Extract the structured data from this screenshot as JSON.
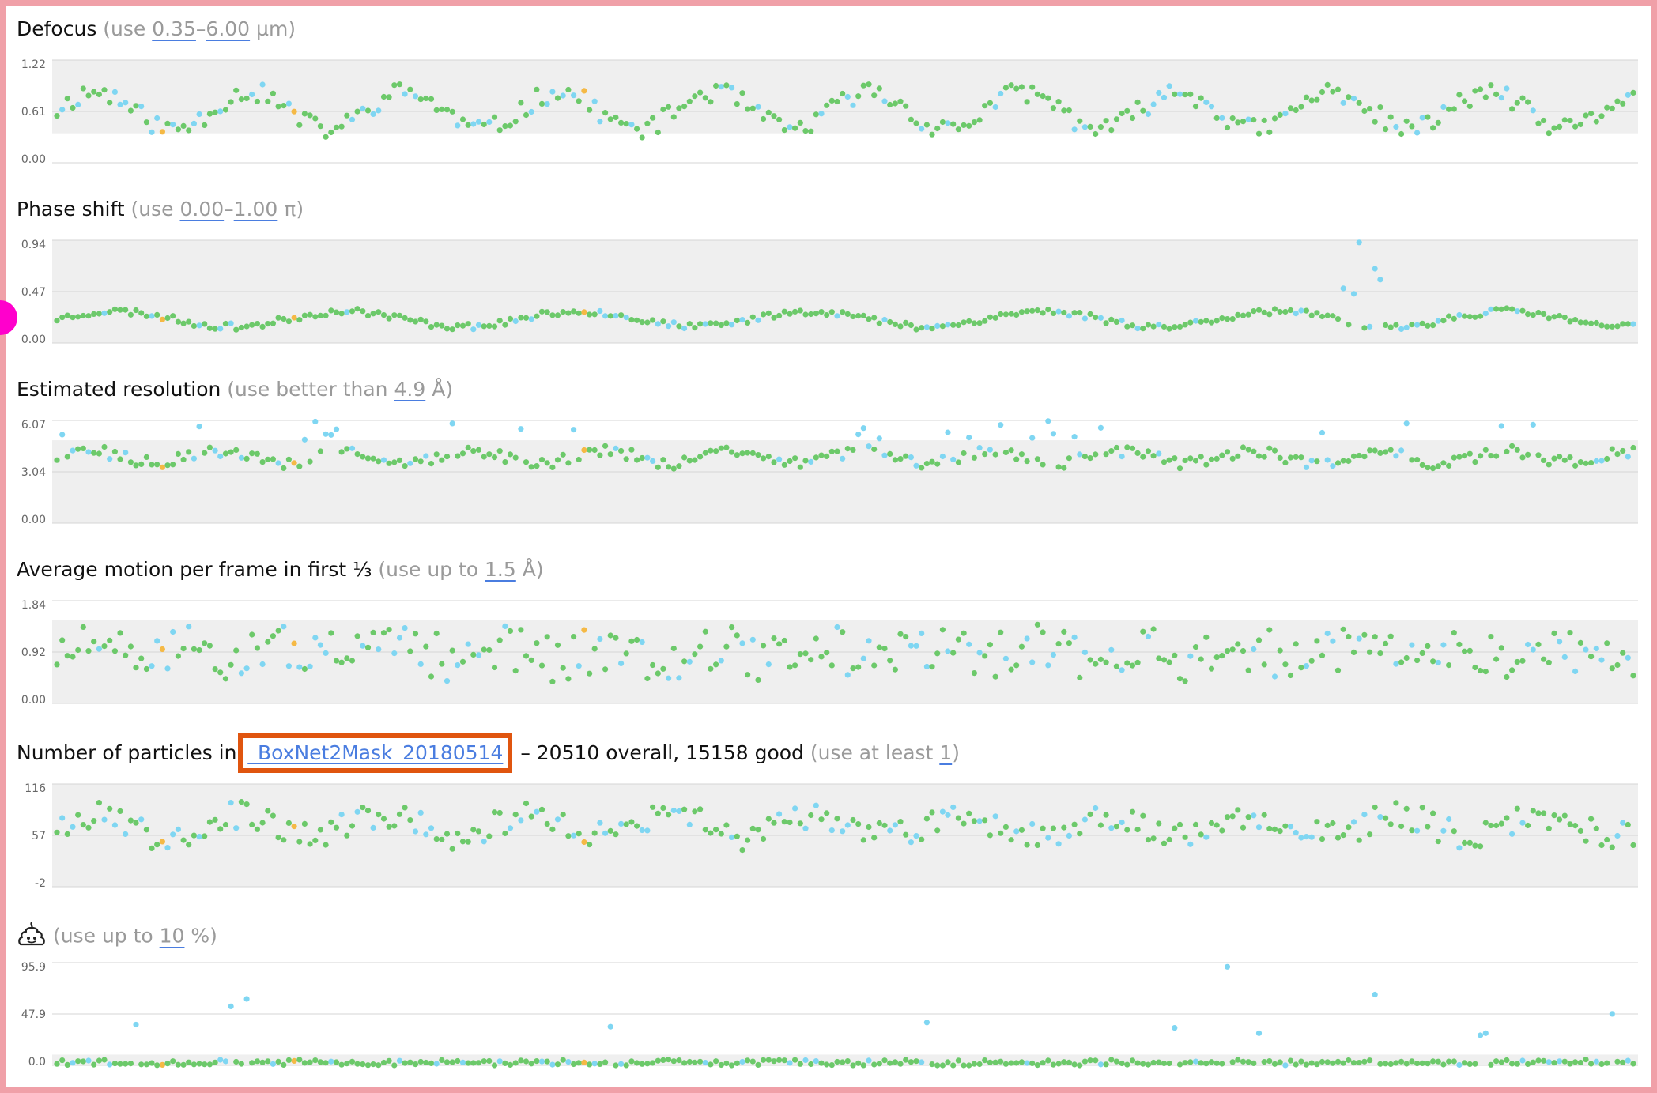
{
  "colors": {
    "good": "#6cc96a",
    "bad": "#7fd6f2",
    "selected": "#f5b945",
    "band": "#efefef"
  },
  "sections": [
    {
      "title": "Defocus",
      "hint_open": " (use ",
      "v1": "0.35",
      "sep": "–",
      "v2": "6.00",
      "hint_close": " µm)"
    },
    {
      "title": "Phase shift",
      "hint_open": " (use ",
      "v1": "0.00",
      "sep": "–",
      "v2": "1.00",
      "hint_close": " π)"
    },
    {
      "title": "Estimated resolution",
      "hint_open": " (use better than ",
      "v1": "4.9",
      "hint_close": " Å)"
    },
    {
      "title": "Average motion per frame in first ⅓",
      "hint_open": " (use up to ",
      "v1": "1.5",
      "hint_close": " Å)"
    },
    {
      "title": "Number of particles in",
      "picker": "_BoxNet2Mask_20180514",
      "stats": " – 20510 overall, 15158 good",
      "hint_open": " (use at least ",
      "v1": "1",
      "hint_close": ")"
    },
    {
      "title": "",
      "icon": "poop-icon",
      "hint_open": "(use up to ",
      "v1": "10",
      "hint_close": " %)"
    }
  ],
  "chart_data": [
    {
      "type": "scatter",
      "title": "Defocus",
      "unit": "µm",
      "ylim": [
        0.0,
        1.22
      ],
      "yticks": [
        "1.22",
        "0.61",
        "0.00"
      ],
      "band": [
        0.35,
        1.22
      ],
      "n": 300,
      "base": 0.62,
      "amp": 0.22,
      "freq": 0.075,
      "jitter": 0.12,
      "seed": 11,
      "bad_rule": "wave_low"
    },
    {
      "type": "scatter",
      "title": "Phase shift",
      "unit": "π",
      "ylim": [
        0.0,
        0.94
      ],
      "yticks": [
        "0.94",
        "0.47",
        "0.00"
      ],
      "band": [
        0.0,
        0.94
      ],
      "n": 300,
      "base": 0.22,
      "amp": 0.07,
      "freq": 0.05,
      "jitter": 0.03,
      "seed": 23,
      "outliers": [
        [
          247,
          0.92
        ],
        [
          250,
          0.68
        ],
        [
          251,
          0.58
        ],
        [
          244,
          0.5
        ],
        [
          246,
          0.45
        ],
        [
          249,
          0.15
        ]
      ]
    },
    {
      "type": "scatter",
      "title": "Estimated resolution",
      "unit": "Å",
      "ylim": [
        0.0,
        6.07
      ],
      "yticks": [
        "6.07",
        "3.04",
        "0.00"
      ],
      "band": [
        0.0,
        4.9
      ],
      "n": 300,
      "base": 3.9,
      "amp": 0.35,
      "freq": 0.09,
      "jitter": 0.35,
      "seed": 37,
      "bad_rule": "above_band"
    },
    {
      "type": "scatter",
      "title": "Average motion per frame in first ⅓",
      "unit": "Å",
      "ylim": [
        0.0,
        1.84
      ],
      "yticks": [
        "1.84",
        "0.92",
        "0.00"
      ],
      "band": [
        0.0,
        1.5
      ],
      "n": 300,
      "base": 0.9,
      "amp": 0.1,
      "freq": 0.11,
      "jitter": 0.42,
      "seed": 51,
      "bad_rule": "random"
    },
    {
      "type": "scatter",
      "title": "Number of particles",
      "ylim": [
        -2,
        116
      ],
      "yticks": [
        "116",
        "57",
        "-2"
      ],
      "band": [
        -2,
        116
      ],
      "n": 300,
      "base": 68,
      "amp": 12,
      "freq": 0.08,
      "jitter": 16,
      "seed": 67,
      "bad_rule": "random"
    },
    {
      "type": "scatter",
      "title": "(use up to 10 %)",
      "unit": "%",
      "ylim": [
        0.0,
        95.9
      ],
      "yticks": [
        "95.9",
        "47.9",
        "0.0"
      ],
      "band": [
        0.0,
        10
      ],
      "n": 300,
      "base": 2.5,
      "amp": 0.5,
      "freq": 0.1,
      "jitter": 2.5,
      "seed": 79,
      "outliers": [
        [
          222,
          92
        ],
        [
          250,
          66
        ],
        [
          33,
          55
        ],
        [
          36,
          62
        ],
        [
          295,
          48
        ],
        [
          15,
          38
        ],
        [
          105,
          36
        ],
        [
          165,
          40
        ],
        [
          212,
          35
        ],
        [
          228,
          30
        ],
        [
          270,
          28
        ],
        [
          271,
          30
        ]
      ]
    }
  ]
}
